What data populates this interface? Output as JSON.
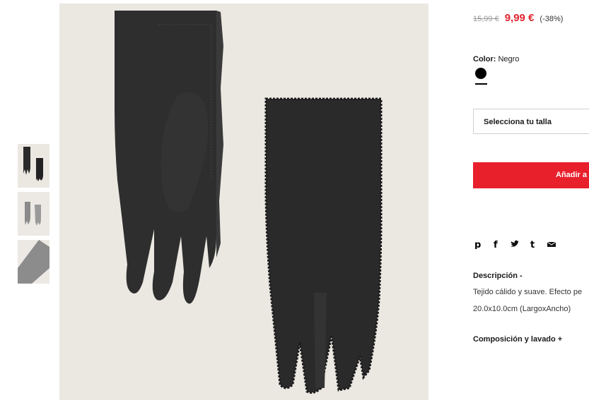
{
  "product": {
    "old_price": "15,99 €",
    "new_price": "9,99 €",
    "discount": "(-38%)",
    "color_label": "Color:",
    "color_value": "Negro",
    "size_placeholder": "Selecciona tu talla",
    "add_button": "Añadir a",
    "description_title": "Descripción -",
    "description_text": "Tejido cálido y suave. Efecto pe",
    "dimensions": "20.0x10.0cm (LargoxAncho)",
    "composition_title": "Composición y lavado +"
  },
  "share": {
    "pinterest": "pinterest-icon",
    "facebook": "facebook-icon",
    "twitter": "twitter-icon",
    "tumblr": "tumblr-icon",
    "email": "email-icon"
  },
  "colors": {
    "accent": "#e1242f",
    "button": "#e8202c",
    "swatch": "#000000"
  }
}
